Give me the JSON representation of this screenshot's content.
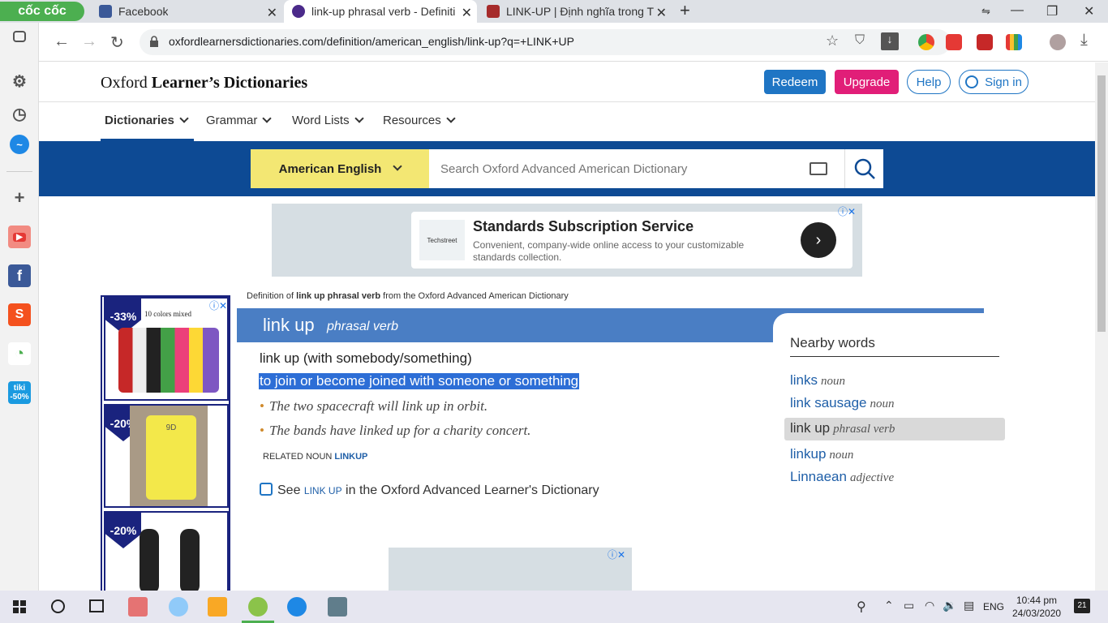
{
  "browser": {
    "brand": "cốc cốc",
    "tabs": [
      {
        "title": "Facebook",
        "icon": "facebook-icon",
        "color": "#3b5998"
      },
      {
        "title": "link-up phrasal verb - Definiti",
        "icon": "oxford-icon",
        "color": "#4b2a8a",
        "active": true
      },
      {
        "title": "LINK-UP | Định nghĩa trong T",
        "icon": "cambridge-icon",
        "color": "#a62b2b"
      }
    ],
    "url": "oxfordlearnersdictionaries.com/definition/american_english/link-up?q=+LINK+UP"
  },
  "site": {
    "logo_plain": "Oxford ",
    "logo_bold": "Learner’s Dictionaries",
    "buttons": {
      "redeem": "Redeem",
      "upgrade": "Upgrade",
      "help": "Help",
      "signin": "Sign in"
    },
    "nav": [
      "Dictionaries",
      "Grammar",
      "Word Lists",
      "Resources"
    ],
    "dict_select": "American English",
    "search_placeholder": "Search Oxford Advanced American Dictionary"
  },
  "ad_top": {
    "title": "Standards Subscription Service",
    "desc": "Convenient, company-wide online access to your customizable standards collection.",
    "brand": "Techstreet"
  },
  "side_ad": {
    "items": [
      {
        "badge": "-33%",
        "caption": "10 colors mixed"
      },
      {
        "badge": "-20%",
        "caption": "9D"
      },
      {
        "badge": "-20%",
        "caption": ""
      }
    ]
  },
  "entry": {
    "source_prefix": "Definition of ",
    "source_word": "link up phrasal verb",
    "source_suffix": " from the Oxford Advanced American Dictionary",
    "headword": "link up",
    "pos": "phrasal verb",
    "phrase": "link up (with somebody/something)",
    "definition": "to join or become joined with someone or something",
    "examples": [
      "The two spacecraft will link up in orbit.",
      "The bands have linked up for a charity concert."
    ],
    "related_label": "RELATED NOUN ",
    "related_word": "LINKUP",
    "see_prefix": "See ",
    "see_word": "LINK UP",
    "see_suffix": " in the Oxford Advanced Learner's Dictionary"
  },
  "nearby": {
    "title": "Nearby words",
    "items": [
      {
        "word": "links",
        "pos": "noun"
      },
      {
        "word": "link sausage",
        "pos": "noun"
      },
      {
        "word": "link up",
        "pos": "phrasal verb",
        "selected": true
      },
      {
        "word": "linkup",
        "pos": "noun"
      },
      {
        "word": "Linnaean",
        "pos": "adjective"
      }
    ]
  },
  "taskbar": {
    "lang": "ENG",
    "time": "10:44 pm",
    "date": "24/03/2020",
    "notif": "21"
  }
}
